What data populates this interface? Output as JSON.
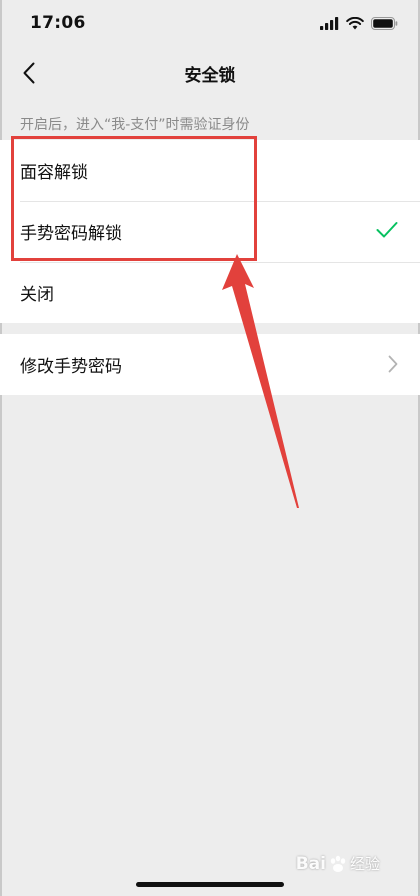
{
  "status_bar": {
    "time": "17:06",
    "icons": [
      "cellular-signal-icon",
      "wifi-icon",
      "battery-icon"
    ]
  },
  "nav": {
    "title": "安全锁",
    "back_icon": "chevron-left-icon"
  },
  "hint": "开启后，进入“我-支付”时需验证身份",
  "options": [
    {
      "label": "面容解锁",
      "selected": false
    },
    {
      "label": "手势密码解锁",
      "selected": true
    },
    {
      "label": "关闭",
      "selected": false
    }
  ],
  "settings": [
    {
      "label": "修改手势密码",
      "icon": "chevron-right-icon"
    }
  ],
  "annotation": {
    "color": "#e2413c"
  },
  "watermark": {
    "logo": "Bai",
    "text": "经验"
  },
  "colors": {
    "background": "#ededed",
    "card": "#ffffff",
    "check": "#07c160",
    "hint": "#8a8a8a"
  }
}
